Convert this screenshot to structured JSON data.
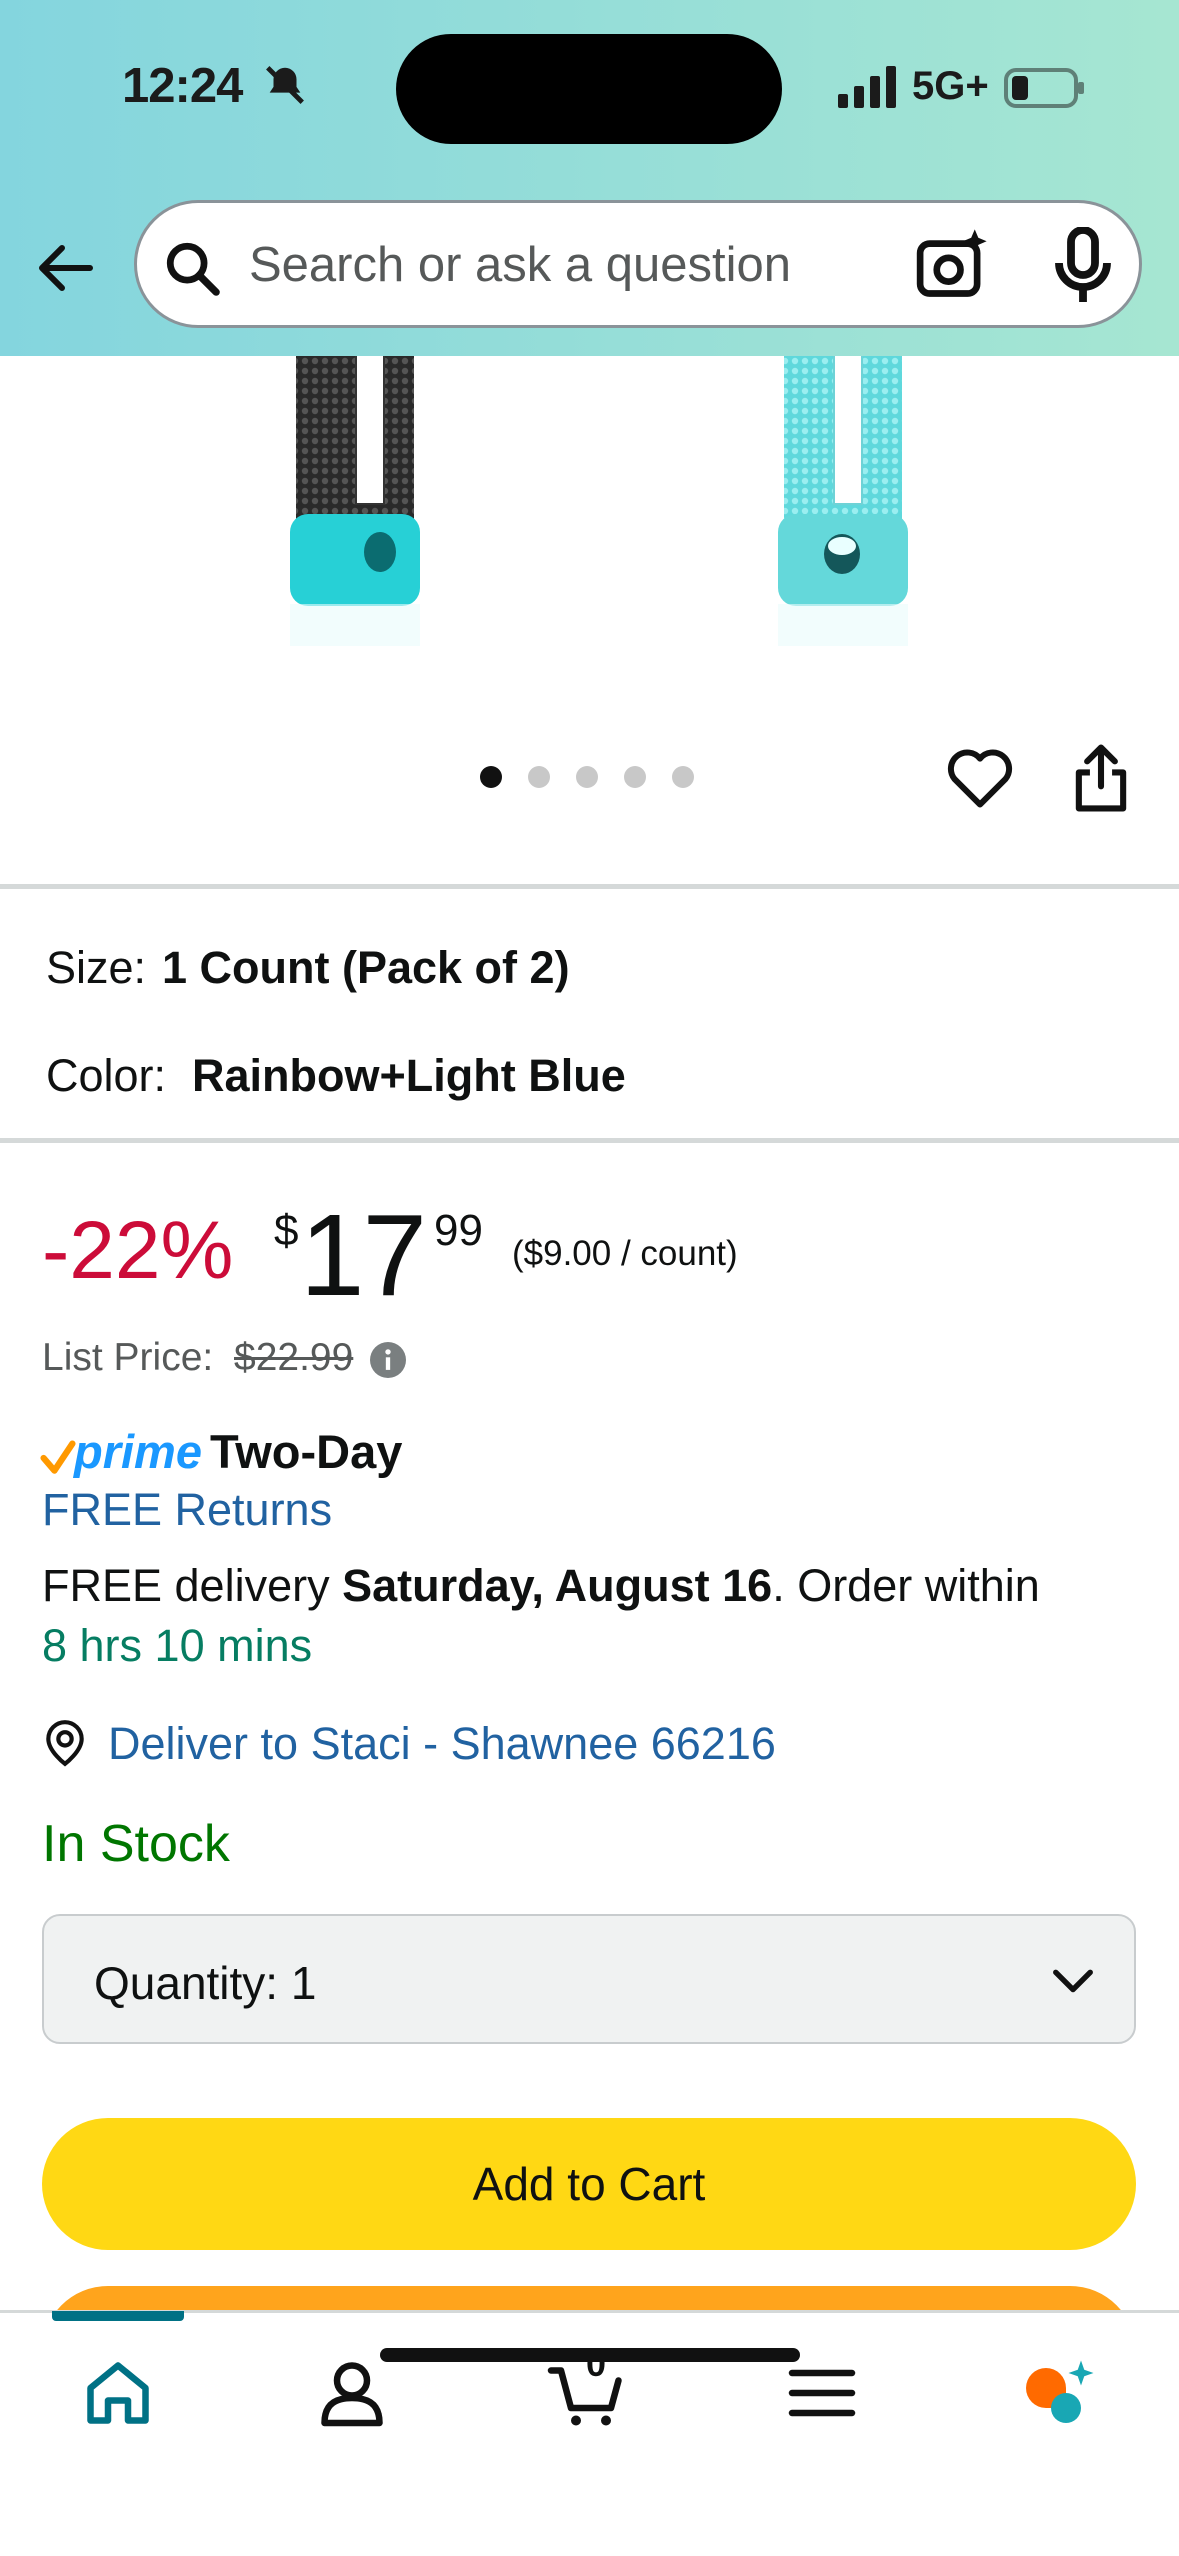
{
  "status_bar": {
    "time": "12:24",
    "network": "5G+"
  },
  "search": {
    "placeholder": "Search or ask a question"
  },
  "gallery": {
    "dot_count": 5,
    "active_dot": 1
  },
  "options": {
    "size_label": "Size:",
    "size_value": "1 Count (Pack of 2)",
    "color_label": "Color:",
    "color_value": "Rainbow+Light Blue"
  },
  "price": {
    "discount": "-22%",
    "currency": "$",
    "whole": "17",
    "fraction": "99",
    "unit_price": "($9.00 / count)",
    "list_price_label": "List Price:",
    "list_price_value": "$22.99"
  },
  "delivery": {
    "prime_logo": "prime",
    "prime_label": "Two-Day",
    "free_returns": "FREE Returns",
    "line_prefix": "FREE delivery ",
    "date": "Saturday, August 16",
    "line_suffix": ". Order within",
    "countdown": "8 hrs 10 mins",
    "deliver_to": "Deliver to Staci - Shawnee 66216"
  },
  "stock": {
    "status": "In Stock"
  },
  "quantity": {
    "label": "Quantity:",
    "value": "1"
  },
  "actions": {
    "add_to_cart": "Add to Cart"
  },
  "bottom_nav": {
    "cart_count": "0"
  },
  "colors": {
    "discount": "#cc0c39",
    "link": "#2162a1",
    "in_stock": "#007600",
    "countdown": "#067d62",
    "add_to_cart": "#ffd814",
    "buy_now": "#ffa41c",
    "header_start": "#84d5de",
    "header_end": "#a6e6d2"
  }
}
